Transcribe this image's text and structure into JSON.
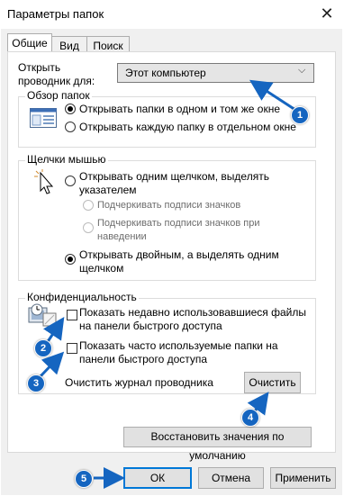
{
  "window": {
    "title": "Параметры папок",
    "close_label": "✕"
  },
  "tabs": [
    {
      "label": "Общие"
    },
    {
      "label": "Вид"
    },
    {
      "label": "Поиск"
    }
  ],
  "open_explorer": {
    "label": "Открыть проводник для:",
    "selected": "Этот компьютер"
  },
  "browse_folders": {
    "title": "Обзор папок",
    "options": [
      {
        "label": "Открывать папки в одном и том же окне",
        "checked": true
      },
      {
        "label": "Открывать каждую папку в отдельном окне",
        "checked": false
      }
    ]
  },
  "mouse_clicks": {
    "title": "Щелчки мышью",
    "single_click": "Открывать одним щелчком, выделять указателем",
    "underline_always": "Подчеркивать подписи значков",
    "underline_hover": "Подчеркивать подписи значков при наведении",
    "double_click": "Открывать двойным, а выделять одним щелчком"
  },
  "privacy": {
    "title": "Конфиденциальность",
    "show_recent_files": "Показать недавно использовавшиеся файлы на панели быстрого доступа",
    "show_frequent_folders": "Показать часто используемые папки на панели быстрого доступа",
    "clear_history_label": "Очистить журнал проводника",
    "clear_button": "Очистить"
  },
  "restore_defaults_button": "Восстановить значения по умолчанию",
  "footer": {
    "ok": "ОК",
    "cancel": "Отмена",
    "apply": "Применить"
  },
  "annotations": [
    "1",
    "2",
    "3",
    "4",
    "5"
  ],
  "colors": {
    "accent": "#0078d7",
    "badge": "#1565c0"
  }
}
